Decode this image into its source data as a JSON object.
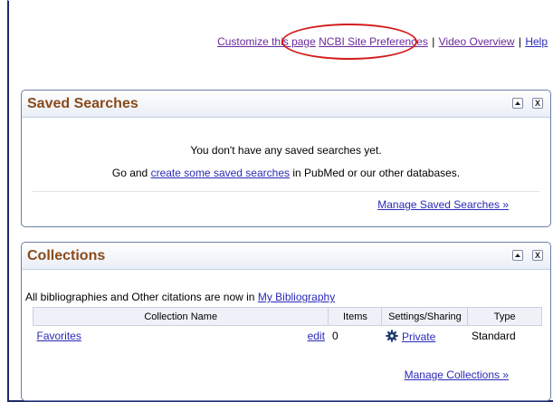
{
  "toplinks": {
    "customize": "Customize this page",
    "preferences": "NCBI Site Preferences",
    "video": "Video Overview",
    "separator": "|",
    "help": "Help"
  },
  "saved_searches": {
    "title": "Saved Searches",
    "message": "You don't have any saved searches yet.",
    "prompt_prefix": "Go and",
    "prompt_link": "create some saved searches",
    "prompt_suffix": "in PubMed or our other databases.",
    "manage_link": "Manage Saved Searches »"
  },
  "collections": {
    "title": "Collections",
    "intro_text": "All bibliographies and Other citations are now in",
    "intro_link": "My Bibliography",
    "columns": [
      "Collection Name",
      "Items",
      "Settings/Sharing",
      "Type"
    ],
    "rows": [
      {
        "name": "Favorites",
        "edit": "edit",
        "items": "0",
        "sharing": "Private",
        "type": "Standard"
      }
    ],
    "manage_link": "Manage Collections »"
  },
  "controls": {
    "close": "X"
  },
  "colors": {
    "title": "#8a4a1a",
    "link": "#2a2ab8",
    "highlight_circle": "#d41c1c",
    "border": "#1f2a6b"
  }
}
